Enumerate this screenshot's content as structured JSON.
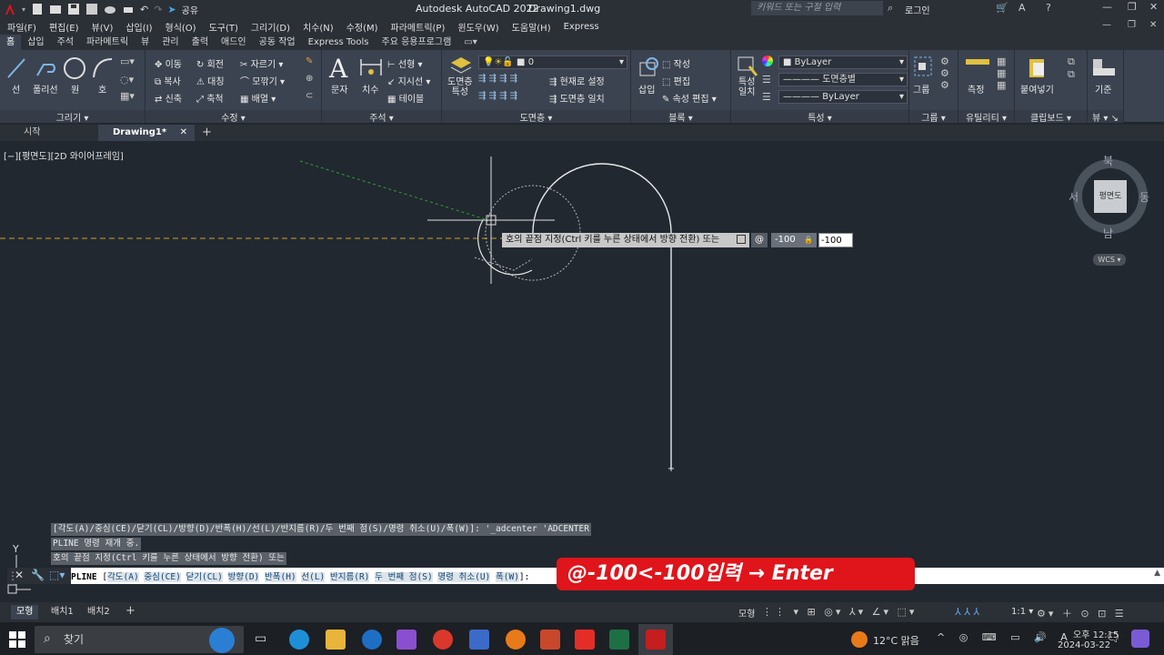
{
  "titlebar": {
    "app": "Autodesk AutoCAD 2022",
    "document": "Drawing1.dwg",
    "share_label": "공유",
    "search_placeholder": "키워드 또는 구절 입력",
    "login_label": "로그인"
  },
  "menubar": [
    "파일(F)",
    "편집(E)",
    "뷰(V)",
    "삽입(I)",
    "형식(O)",
    "도구(T)",
    "그리기(D)",
    "치수(N)",
    "수정(M)",
    "파라메트릭(P)",
    "윈도우(W)",
    "도움말(H)",
    "Express"
  ],
  "ribbon_tabs": [
    "홈",
    "삽입",
    "주석",
    "파라메트릭",
    "뷰",
    "관리",
    "출력",
    "애드인",
    "공동 작업",
    "Express Tools",
    "주요 응용프로그램"
  ],
  "ribbon": {
    "draw": {
      "line": "선",
      "polyline": "폴리선",
      "circle": "원",
      "arc": "호",
      "panel": "그리기"
    },
    "modify": {
      "move": "이동",
      "rotate": "회전",
      "trim": "자르기",
      "copy": "복사",
      "mirror": "대칭",
      "fillet": "모깎기",
      "stretch": "신축",
      "scale": "축척",
      "array": "배열",
      "panel": "수정"
    },
    "annotation": {
      "text": "문자",
      "dimension": "치수",
      "linear": "선형",
      "leader": "지시선",
      "table": "테이블",
      "panel": "주석"
    },
    "layers": {
      "props": "도면층\n특성",
      "layer_name": "0",
      "make_current": "현재로 설정",
      "match": "도면층 일치",
      "panel": "도면층"
    },
    "block": {
      "insert": "삽입",
      "create": "작성",
      "edit": "편집",
      "attr_edit": "속성 편집",
      "panel": "블록"
    },
    "properties": {
      "match": "특성\n일치",
      "color": "ByLayer",
      "linetype": "도면층별",
      "lineweight": "ByLayer",
      "panel": "특성"
    },
    "groups": {
      "group": "그룹",
      "panel": "그룹"
    },
    "utilities": {
      "measure": "측정",
      "panel": "유틸리티"
    },
    "clipboard": {
      "paste": "붙여넣기",
      "panel": "클립보드"
    },
    "view": {
      "base": "기준",
      "panel": "뷰"
    }
  },
  "doc_tabs": [
    "시작",
    "Drawing1*"
  ],
  "view_label": "[−][평면도][2D 와이어프레임]",
  "dynamic_input": {
    "prompt": "호의 끝점 지정(Ctrl 키를 누른 상태에서 방향 전환) 또는",
    "at": "@",
    "value1": "-100",
    "value2": "-100"
  },
  "viewcube": {
    "north": "북",
    "south": "남",
    "west": "서",
    "east": "동",
    "top": "평면도",
    "wcs": "WCS"
  },
  "command_history": [
    "[각도(A)/중심(CE)/닫기(CL)/방향(D)/반폭(H)/선(L)/반지름(R)/두 번째 점(S)/명령 취소(U)/폭(W)]: '_adcenter 'ADCENTER",
    "PLINE 명령 재개 중.",
    "호의 끝점 지정(Ctrl 키를 누른 상태에서 방향 전환) 또는"
  ],
  "command_line": {
    "command": "PLINE",
    "options": [
      "각도(A)",
      "중심(CE)",
      "닫기(CL)",
      "방향(D)",
      "반폭(H)",
      "선(L)",
      "반지름(R)",
      "두 번째 점(S)",
      "명령 취소(U)",
      "폭(W)"
    ]
  },
  "annotation": "@-100<-100입력 → Enter",
  "layout_tabs": [
    "모형",
    "배치1",
    "배치2"
  ],
  "status": {
    "model": "모형",
    "scale": "1:1"
  },
  "taskbar": {
    "search": "찾기",
    "weather": "12°C 맑음",
    "time": "오후 12:15",
    "date": "2024-03-22"
  },
  "colors": {
    "canvas": "#212830",
    "ribbon": "#3b4350",
    "accent_red": "#e0141b"
  }
}
